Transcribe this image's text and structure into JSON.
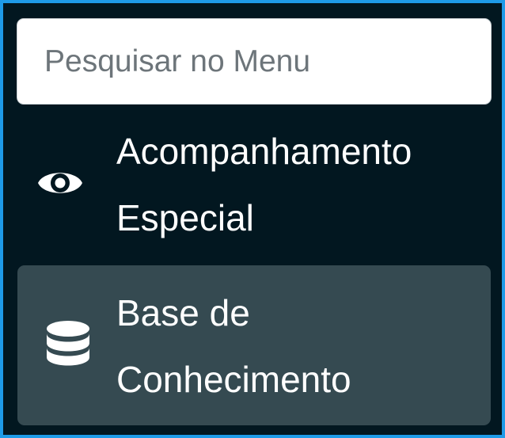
{
  "search": {
    "placeholder": "Pesquisar no Menu",
    "value": ""
  },
  "menu": {
    "items": [
      {
        "label": "Acompanhamento Especial",
        "icon": "eye-icon",
        "active": false
      },
      {
        "label": "Base de Conhecimento",
        "icon": "database-icon",
        "active": true
      }
    ]
  },
  "colors": {
    "background": "#021720",
    "border": "#1e9be8",
    "active_item": "#354a51",
    "text": "#ffffff",
    "placeholder": "#6d757a"
  }
}
